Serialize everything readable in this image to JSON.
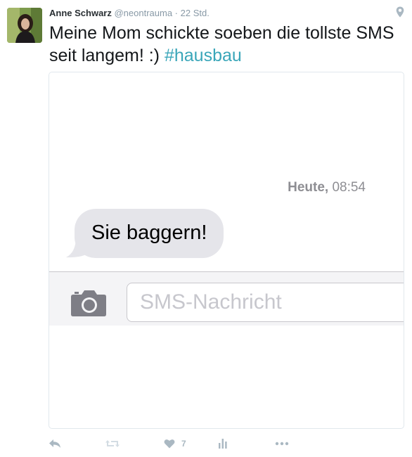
{
  "tweet": {
    "author_name": "Anne Schwarz",
    "handle": "@neontrauma",
    "separator": " · ",
    "time": "22 Std.",
    "text": "Meine Mom schickte soeben die tollste SMS seit langem! :) ",
    "hashtag": "#hausbau"
  },
  "sms": {
    "timestamp_day": "Heute,",
    "timestamp_time": " 08:54",
    "message": "Sie baggern!",
    "input_placeholder": "SMS-Nachricht"
  },
  "actions": {
    "like_count": "7"
  },
  "icons": [
    "map-pin-icon",
    "camera-icon",
    "reply-icon",
    "retweet-icon",
    "heart-icon",
    "analytics-icon",
    "more-icon"
  ],
  "colors": {
    "hashtag": "#3aa6b9",
    "bubble": "#e5e5ea",
    "muted": "#aab8c2"
  }
}
